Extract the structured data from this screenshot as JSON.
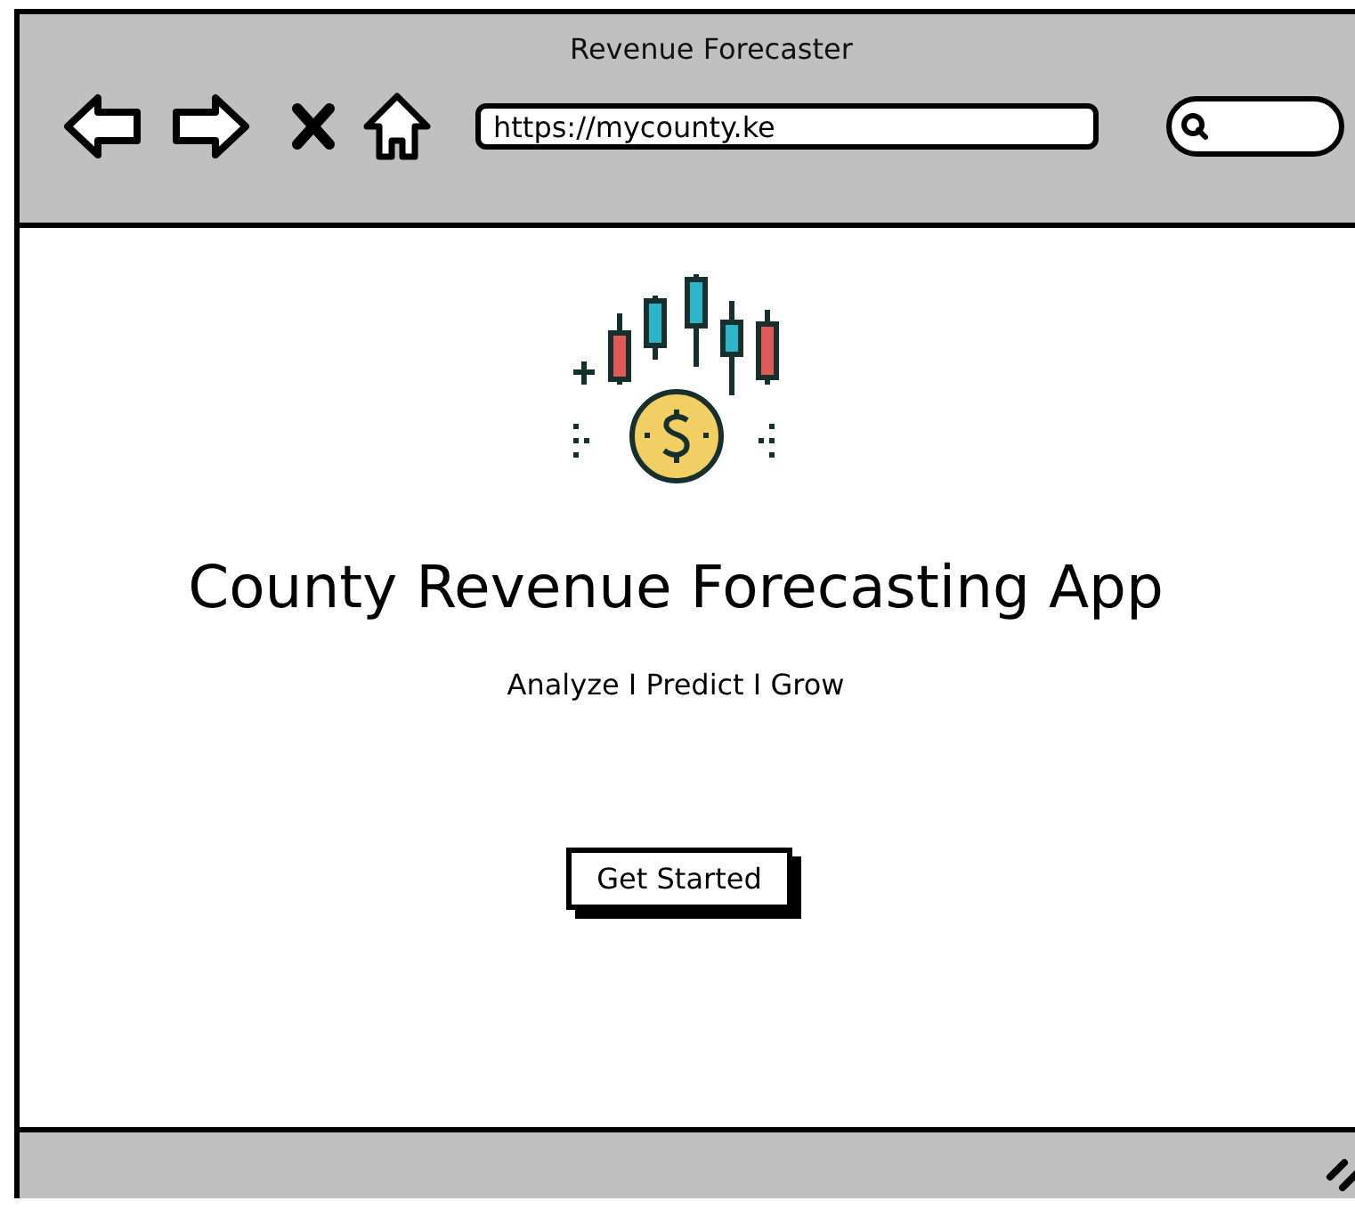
{
  "window": {
    "title": "Revenue Forecaster"
  },
  "address_bar": {
    "value": "https://mycounty.ke"
  },
  "hero": {
    "heading": "County Revenue Forecasting App",
    "tagline": "Analyze I Predict I Grow"
  },
  "buttons": [
    {
      "label": "Get Started"
    }
  ]
}
